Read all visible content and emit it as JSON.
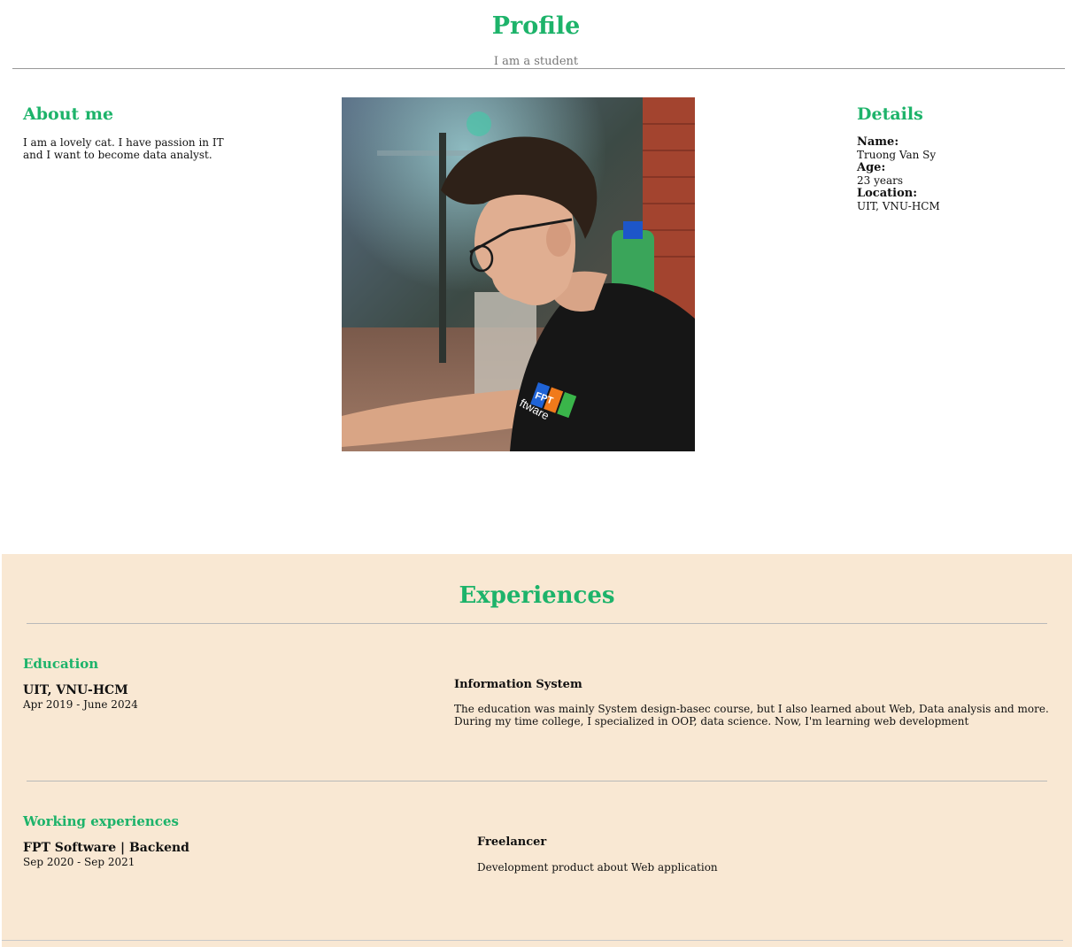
{
  "header": {
    "title": "Profile",
    "subtitle": "I am a student"
  },
  "about": {
    "title": "About me",
    "text": "I am a lovely cat. I have passion in IT and I want to become data analyst."
  },
  "details": {
    "title": "Details",
    "name_label": "Name:",
    "name_value": "Truong Van Sy",
    "age_label": "Age:",
    "age_value": "23 years",
    "location_label": "Location:",
    "location_value": "UIT, VNU-HCM"
  },
  "photo": {
    "logo_text": "FPT",
    "sleeve_text": "ftware"
  },
  "experiences": {
    "title": "Experiences",
    "education": {
      "section_title": "Education",
      "place": "UIT, VNU-HCM",
      "dates": "Apr 2019 - June 2024",
      "role": "Information System",
      "description_line1": "The education was mainly System design-basec course, but I also learned about Web, Data analysis and more.",
      "description_line2": "During my time college, I specialized in OOP, data science. Now, I'm learning web development"
    },
    "work": {
      "section_title": "Working experiences",
      "place": "FPT Software | Backend",
      "dates": "Sep 2020 - Sep 2021",
      "role": "Freelancer",
      "description": "Development product about Web application"
    }
  },
  "colors": {
    "accent": "#1db36a",
    "section_bg": "#f9e8d3"
  }
}
